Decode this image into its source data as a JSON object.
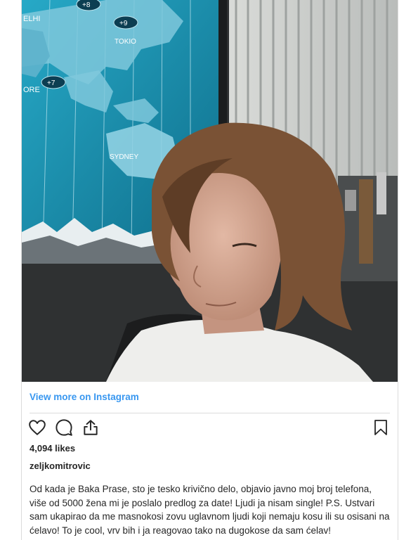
{
  "post": {
    "image_alt_labels": {
      "delhi": "ELHI",
      "tokyo": "TOKIO",
      "sydney": "SYDNEY",
      "singapore": "ORE",
      "tz_plus_8": "+8",
      "tz_plus_9": "+9",
      "tz_plus_7": "+7"
    },
    "view_more": "View more on Instagram",
    "likes": "4,094 likes",
    "username": "zeljkomitrovic",
    "caption": "Od kada je Baka Prase, sto je tesko krivično delo, objavio javno moj broj telefona, više od 5000 žena mi je poslalo predlog za date! Ljudi ja nisam single! P.S. Ustvari sam ukapirao da me masnokosi zovu uglavnom ljudi koji nemaju kosu ili su osisani na ćelavo! To je cool, vrv bih i ja reagovao tako na dugokose da sam ćelav!"
  },
  "icons": {
    "like": "heart-icon",
    "comment": "comment-icon",
    "share": "share-icon",
    "save": "bookmark-icon"
  },
  "colors": {
    "link": "#3897f0",
    "text": "#262626",
    "border": "#dbdbdb",
    "map_blue": "#1e9bb8"
  }
}
